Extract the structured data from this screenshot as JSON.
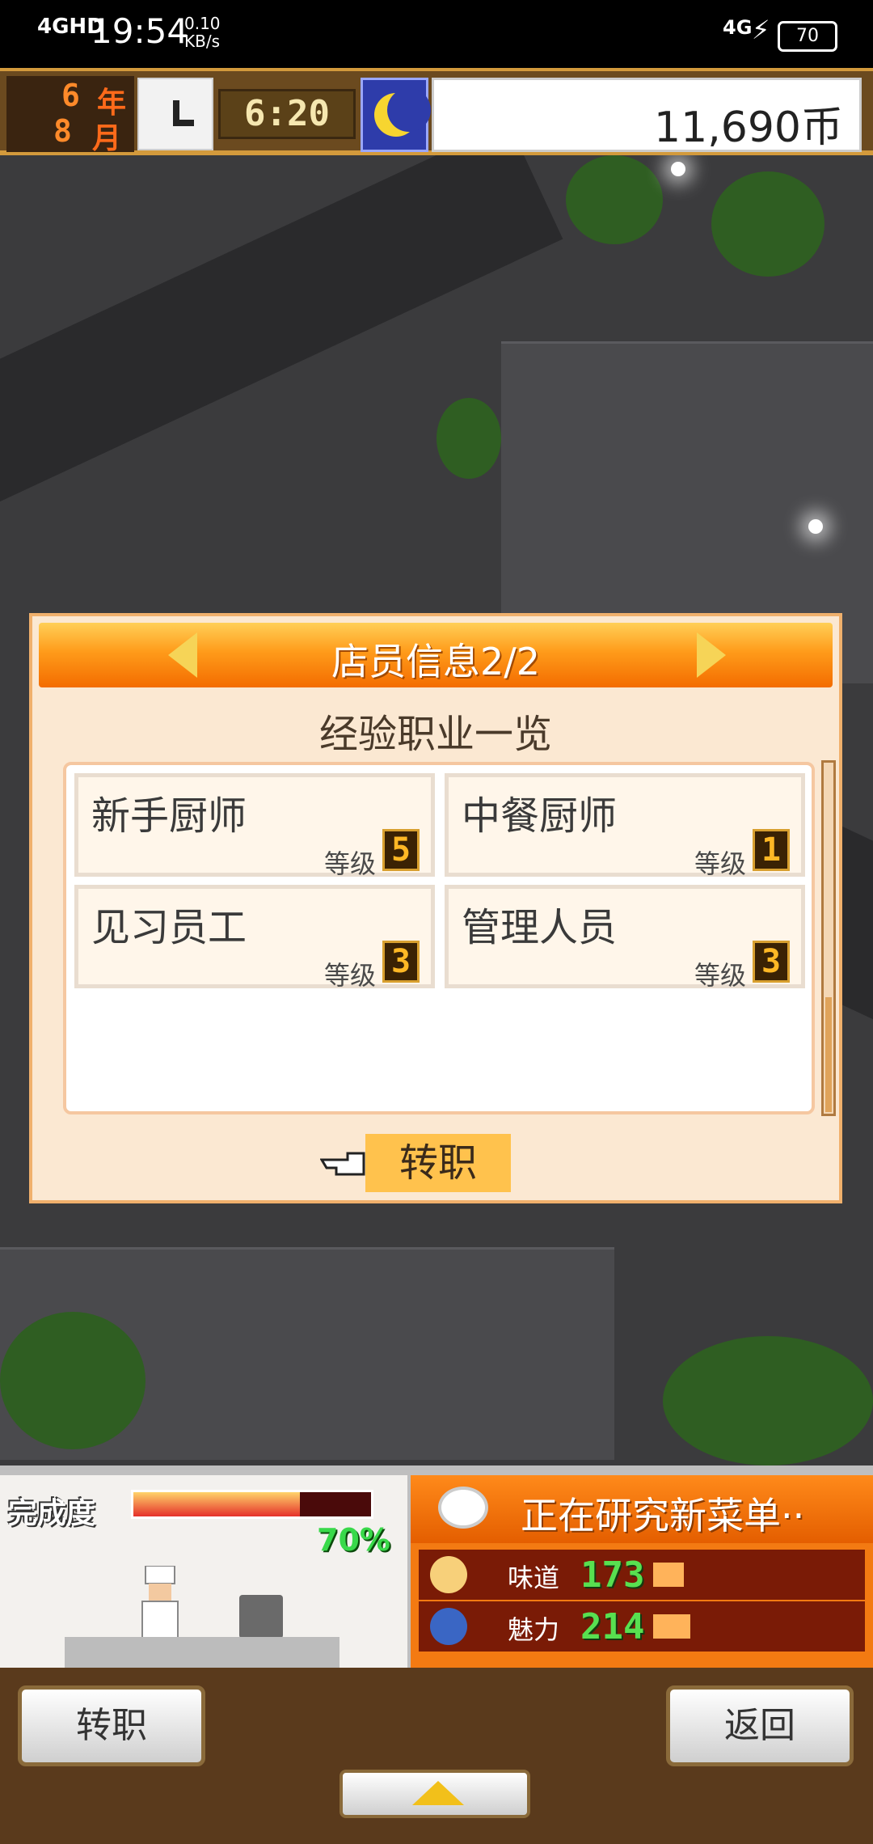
{
  "status_bar": {
    "network": "4GHD",
    "time": "19:54",
    "speed": "0.10",
    "speed_unit": "KB/s",
    "network2": "4G",
    "battery": "70"
  },
  "hud": {
    "year_num": "6",
    "year_label": "年",
    "month_num": "8",
    "month_label": "月",
    "clock_time": "6:20",
    "money": "11,690币"
  },
  "dialog": {
    "title": "店员信息2/2",
    "subtitle": "经验职业一览",
    "jobs": [
      {
        "name": "新手厨师",
        "level_label": "等级",
        "level": "5"
      },
      {
        "name": "中餐厨师",
        "level_label": "等级",
        "level": "1"
      },
      {
        "name": "见习员工",
        "level_label": "等级",
        "level": "3"
      },
      {
        "name": "管理人员",
        "level_label": "等级",
        "level": "3"
      }
    ],
    "change_job_button": "转职"
  },
  "info_panel": {
    "progress_label": "完成度",
    "progress_percent": "70%",
    "progress_value": 0.7,
    "research_text": "正在研究新菜单··",
    "stats": [
      {
        "label": "味道",
        "value": "173"
      },
      {
        "label": "魅力",
        "value": "214"
      }
    ]
  },
  "bottom_bar": {
    "left_button": "转职",
    "right_button": "返回"
  },
  "colors": {
    "accent_orange": "#f36c00",
    "dialog_bg": "#fbe8d2",
    "stat_green": "#58e050"
  }
}
